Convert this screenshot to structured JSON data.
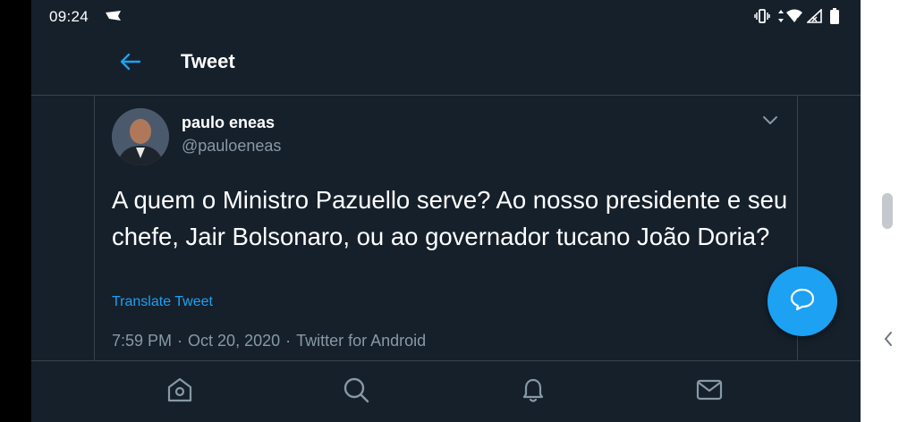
{
  "status_bar": {
    "time": "09:24",
    "icons": [
      "flag-icon",
      "vibrate-icon",
      "data-arrows-icon",
      "wifi-icon",
      "signal-icon",
      "battery-icon"
    ]
  },
  "header": {
    "back_icon": "arrow-left-icon",
    "title": "Tweet"
  },
  "tweet": {
    "author_name": "paulo eneas",
    "author_handle": "@pauloeneas",
    "text": "A quem o Ministro Pazuello serve? Ao nosso presidente e seu chefe, Jair Bolsonaro, ou ao governador tucano João Doria?",
    "translate_label": "Translate Tweet",
    "time": "7:59 PM",
    "date": "Oct 20, 2020",
    "source": "Twitter for Android",
    "separator": "·"
  },
  "bottom_nav": {
    "items": [
      "home-icon",
      "search-icon",
      "notifications-icon",
      "messages-icon"
    ]
  },
  "fab": {
    "icon": "reply-bubble-icon"
  },
  "colors": {
    "background": "#15202b",
    "accent": "#1da1f2",
    "secondary_text": "#8899a6",
    "border": "#38444d"
  }
}
